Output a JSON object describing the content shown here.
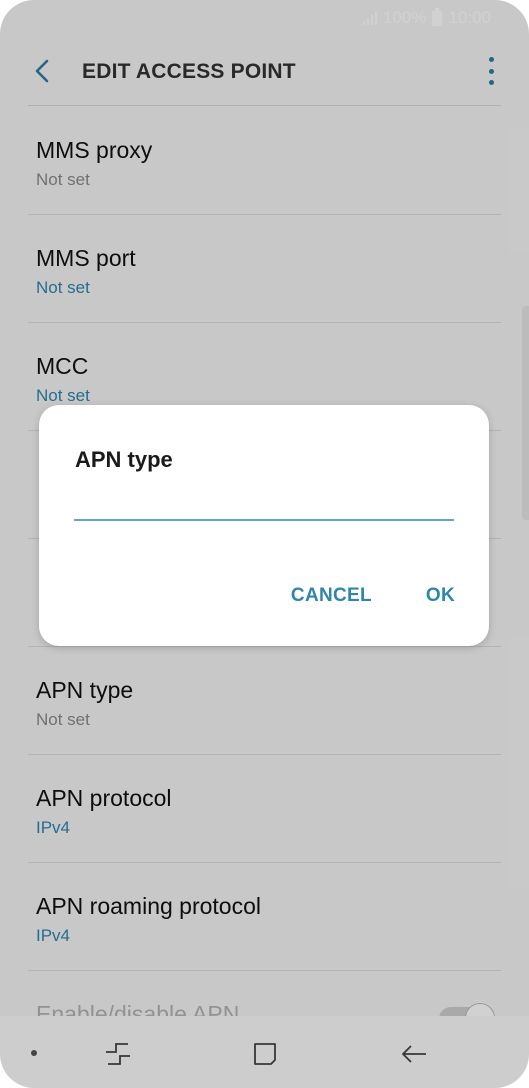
{
  "status_bar": {
    "battery_text": "100%",
    "time": "10:00"
  },
  "app_bar": {
    "title": "EDIT ACCESS POINT",
    "back_icon": "chevron-left-icon",
    "menu_icon": "more-vertical-icon"
  },
  "settings": [
    {
      "title": "MMS proxy",
      "value": "Not set",
      "value_accent": false
    },
    {
      "title": "MMS port",
      "value": "Not set",
      "value_accent": true
    },
    {
      "title": "MCC",
      "value": "Not set",
      "value_accent": true
    },
    {
      "title": "",
      "value": "",
      "value_accent": true
    },
    {
      "title": "",
      "value": "",
      "value_accent": true
    },
    {
      "title": "APN type",
      "value": "Not set",
      "value_accent": false
    },
    {
      "title": "APN protocol",
      "value": "IPv4",
      "value_accent": true
    },
    {
      "title": "APN roaming protocol",
      "value": "IPv4",
      "value_accent": true
    },
    {
      "title": "Enable/disable APN",
      "toggle_state": "on",
      "disabled": true
    }
  ],
  "dialog": {
    "title": "APN type",
    "input_value": "",
    "cancel_label": "CANCEL",
    "ok_label": "OK"
  },
  "nav_bar": {
    "icons": [
      "recents-icon",
      "home-icon",
      "back-icon"
    ]
  },
  "colors": {
    "accent": "#2e86ad",
    "scrim": "rgba(0,0,0,0.18)"
  }
}
